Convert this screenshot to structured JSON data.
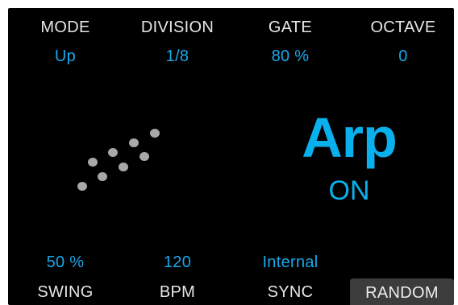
{
  "top_params": [
    {
      "label": "MODE",
      "value": "Up"
    },
    {
      "label": "DIVISION",
      "value": "1/8"
    },
    {
      "label": "GATE",
      "value": "80 %"
    },
    {
      "label": "OCTAVE",
      "value": "0"
    }
  ],
  "bottom_params": [
    {
      "label": "SWING",
      "value": "50 %"
    },
    {
      "label": "BPM",
      "value": "120"
    },
    {
      "label": "SYNC",
      "value": "Internal"
    }
  ],
  "arp": {
    "title": "Arp",
    "state": "ON"
  },
  "random_button": {
    "label": "RANDOM"
  },
  "pattern_icon": "arpeggio-dots-icon",
  "colors": {
    "background": "#000000",
    "label": "#e6e6e6",
    "value": "#1aa7e8",
    "accent": "#0ab0ec",
    "dot": "#a8a8a8",
    "button": "#3c3c3c"
  }
}
